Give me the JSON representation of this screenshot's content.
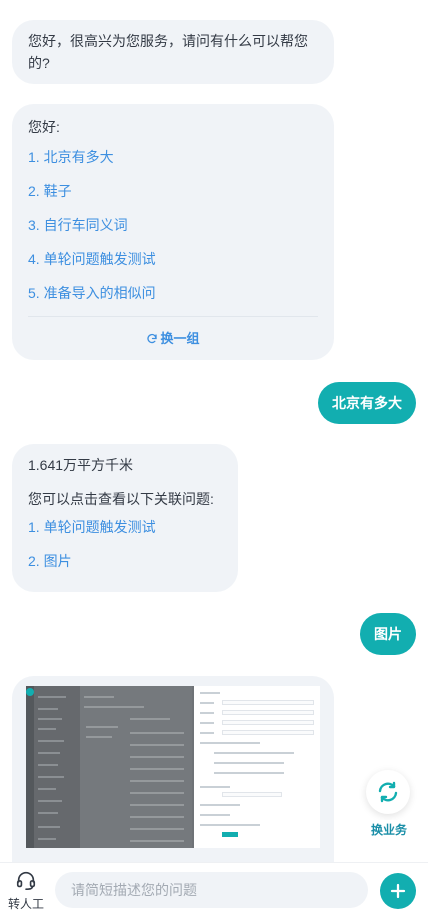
{
  "messages": {
    "greeting": "您好，很高兴为您服务，请问有什么可以帮您的?",
    "menu": {
      "intro": "您好:",
      "items": [
        "1. 北京有多大",
        "2. 鞋子",
        "3. 自行车同义词",
        "4. 单轮问题触发测试",
        "5. 准备导入的相似问"
      ],
      "refresh_label": "换一组"
    },
    "user_1": "北京有多大",
    "answer_1": {
      "text": "1.641万平方千米",
      "related_intro": "您可以点击查看以下关联问题:",
      "related": [
        "1. 单轮问题触发测试",
        "2. 图片"
      ]
    },
    "user_2": "图片"
  },
  "float_button": {
    "label": "换业务",
    "icon": "swap-refresh-icon"
  },
  "bottom_bar": {
    "agent_label": "转人工",
    "agent_icon": "headset-icon",
    "input_placeholder": "请简短描述您的问题",
    "plus_icon": "plus-icon"
  },
  "colors": {
    "accent": "#12aeb0",
    "link": "#3d8fe0",
    "bubble": "#f0f3f7"
  }
}
